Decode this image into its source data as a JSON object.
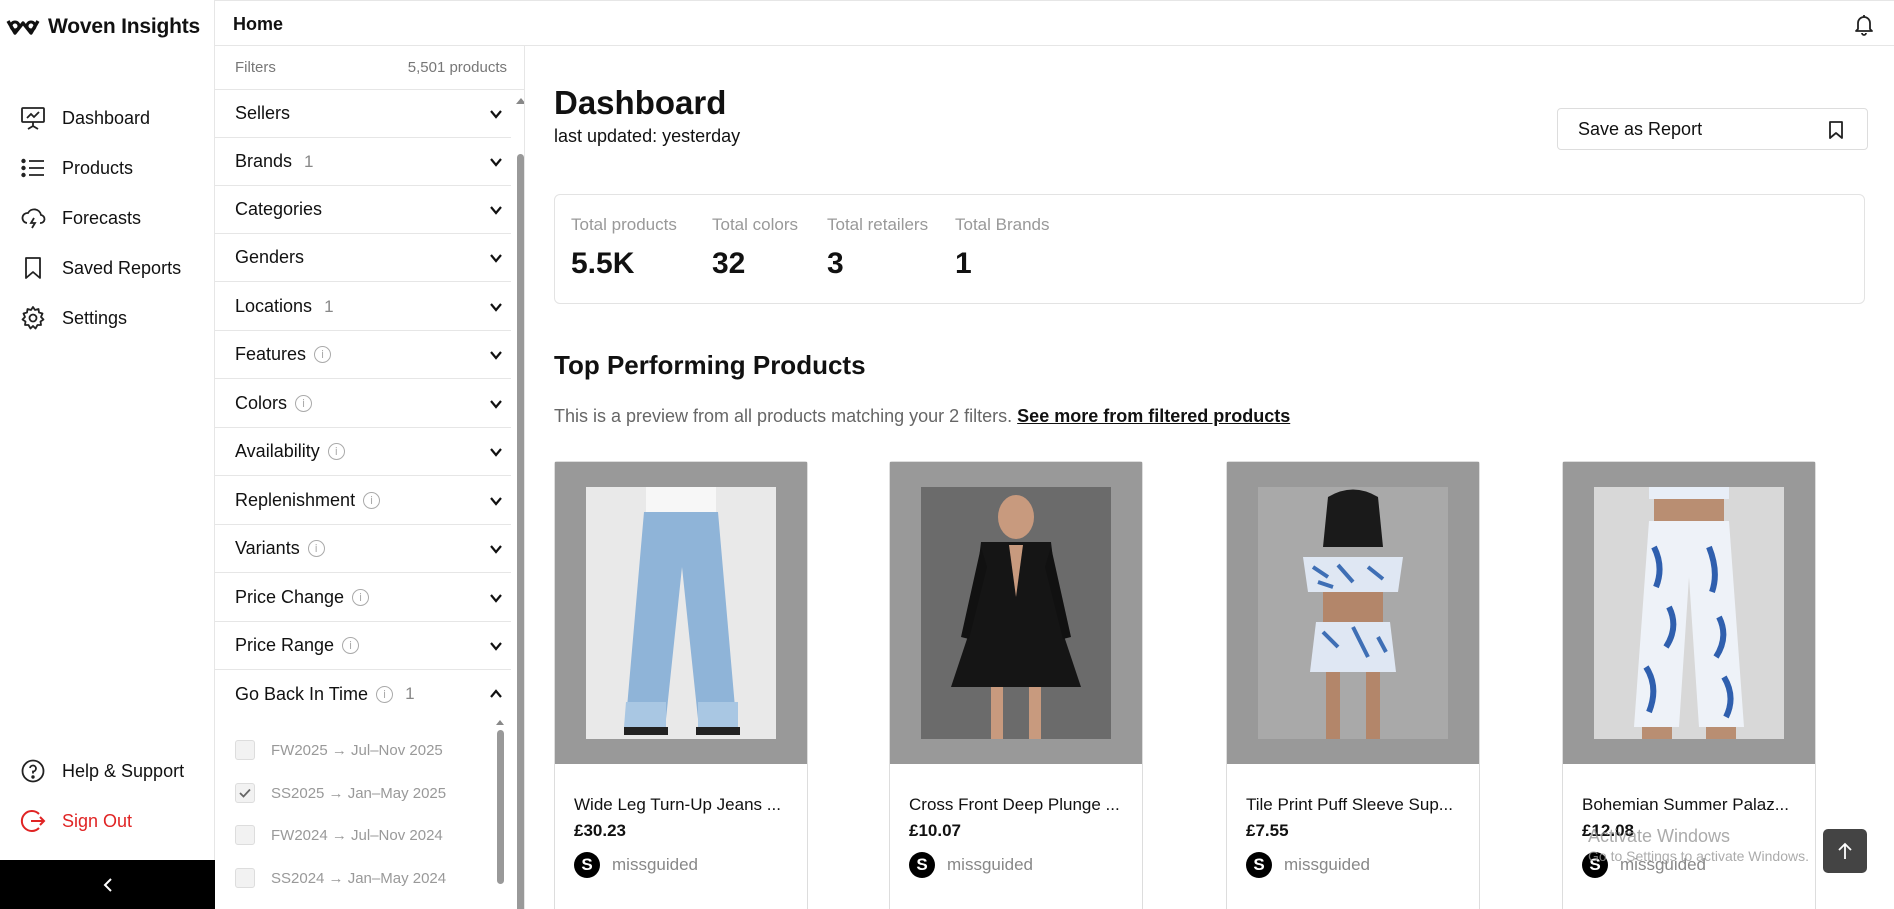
{
  "brand": {
    "name": "Woven Insights"
  },
  "nav": {
    "items": [
      {
        "label": "Dashboard",
        "icon": "presentation-chart-icon"
      },
      {
        "label": "Products",
        "icon": "list-icon"
      },
      {
        "label": "Forecasts",
        "icon": "cloud-lightning-icon"
      },
      {
        "label": "Saved Reports",
        "icon": "bookmark-icon"
      },
      {
        "label": "Settings",
        "icon": "gear-icon"
      }
    ],
    "help_label": "Help & Support",
    "signout_label": "Sign Out"
  },
  "topbar": {
    "title": "Home"
  },
  "filters": {
    "label": "Filters",
    "count": "5,501 products",
    "rows": [
      {
        "label": "Sellers",
        "badge": "",
        "info": false
      },
      {
        "label": "Brands",
        "badge": "1",
        "info": false
      },
      {
        "label": "Categories",
        "badge": "",
        "info": false
      },
      {
        "label": "Genders",
        "badge": "",
        "info": false
      },
      {
        "label": "Locations",
        "badge": "1",
        "info": false
      },
      {
        "label": "Features",
        "badge": "",
        "info": true
      },
      {
        "label": "Colors",
        "badge": "",
        "info": true
      },
      {
        "label": "Availability",
        "badge": "",
        "info": true
      },
      {
        "label": "Replenishment",
        "badge": "",
        "info": true
      },
      {
        "label": "Variants",
        "badge": "",
        "info": true
      },
      {
        "label": "Price Change",
        "badge": "",
        "info": true
      },
      {
        "label": "Price Range",
        "badge": "",
        "info": true
      },
      {
        "label": "Go Back In Time",
        "badge": "1",
        "info": true,
        "expanded": true
      }
    ],
    "time_options": [
      {
        "label": "FW2025 → Jul–Nov 2025",
        "checked": false
      },
      {
        "label": "SS2025 → Jan–May 2025",
        "checked": true
      },
      {
        "label": "FW2024 → Jul–Nov 2024",
        "checked": false
      },
      {
        "label": "SS2024 → Jan–May 2024",
        "checked": false
      }
    ]
  },
  "main": {
    "title": "Dashboard",
    "updated": "last updated: yesterday",
    "save_report_label": "Save as Report",
    "stats": [
      {
        "label": "Total products",
        "value": "5.5K"
      },
      {
        "label": "Total colors",
        "value": "32"
      },
      {
        "label": "Total retailers",
        "value": "3"
      },
      {
        "label": "Total Brands",
        "value": "1"
      }
    ],
    "top_title": "Top Performing Products",
    "preview_text": "This is a preview from all products matching your 2 filters.",
    "preview_link": "See more from filtered products",
    "products": [
      {
        "title": "Wide Leg Turn-Up Jeans ...",
        "price": "£30.23",
        "seller": "missguided",
        "seller_initial": "S"
      },
      {
        "title": "Cross Front Deep Plunge ...",
        "price": "£10.07",
        "seller": "missguided",
        "seller_initial": "S"
      },
      {
        "title": "Tile Print Puff Sleeve Sup...",
        "price": "£7.55",
        "seller": "missguided",
        "seller_initial": "S"
      },
      {
        "title": "Bohemian Summer Palaz...",
        "price": "£12.08",
        "seller": "missguided",
        "seller_initial": "S"
      }
    ]
  },
  "os_watermark": {
    "title": "Activate Windows",
    "subtitle": "Go to Settings to activate Windows."
  },
  "colors": {
    "accent_danger": "#e02424",
    "text": "#111111",
    "muted": "#999999"
  }
}
